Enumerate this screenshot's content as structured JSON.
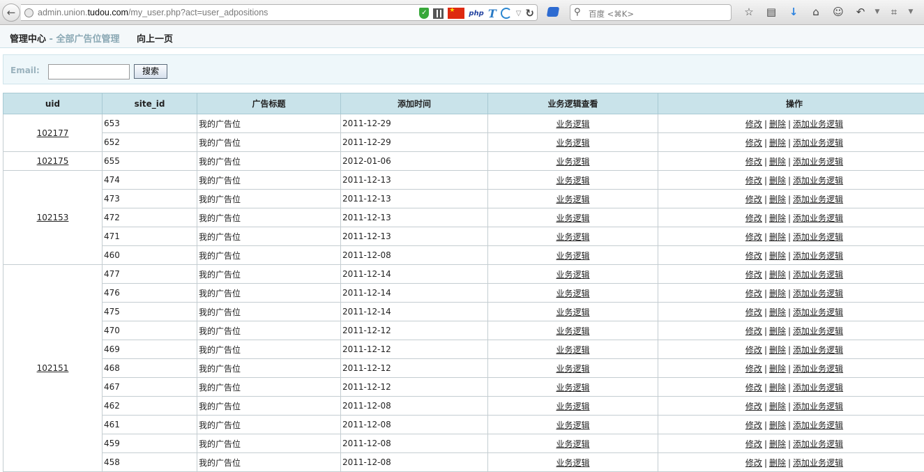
{
  "browser": {
    "url_prefix": "admin.union.",
    "url_host": "tudou.com",
    "url_path": "/my_user.php?act=user_adpositions",
    "search_placeholder": "百度 <⌘K>"
  },
  "nav": {
    "title": "管理中心",
    "subtitle": " - 全部广告位管理",
    "back_link": "向上一页"
  },
  "search": {
    "email_label": "Email:",
    "email_value": "",
    "button_label": "搜索"
  },
  "table": {
    "headers": [
      "uid",
      "site_id",
      "广告标题",
      "添加时间",
      "业务逻辑查看",
      "操作"
    ],
    "link_logic": "业务逻辑",
    "op_edit": "修改",
    "op_delete": "删除",
    "op_add": "添加业务逻辑",
    "groups": [
      {
        "uid": "102177",
        "rows": [
          {
            "site_id": "653",
            "title": "我的广告位",
            "date": "2011-12-29"
          },
          {
            "site_id": "652",
            "title": "我的广告位",
            "date": "2011-12-29"
          }
        ]
      },
      {
        "uid": "102175",
        "rows": [
          {
            "site_id": "655",
            "title": "我的广告位",
            "date": "2012-01-06"
          }
        ]
      },
      {
        "uid": "102153",
        "rows": [
          {
            "site_id": "474",
            "title": "我的广告位",
            "date": "2011-12-13"
          },
          {
            "site_id": "473",
            "title": "我的广告位",
            "date": "2011-12-13"
          },
          {
            "site_id": "472",
            "title": "我的广告位",
            "date": "2011-12-13"
          },
          {
            "site_id": "471",
            "title": "我的广告位",
            "date": "2011-12-13"
          },
          {
            "site_id": "460",
            "title": "我的广告位",
            "date": "2011-12-08"
          }
        ]
      },
      {
        "uid": "102151",
        "rows": [
          {
            "site_id": "477",
            "title": "我的广告位",
            "date": "2011-12-14"
          },
          {
            "site_id": "476",
            "title": "我的广告位",
            "date": "2011-12-14"
          },
          {
            "site_id": "475",
            "title": "我的广告位",
            "date": "2011-12-14"
          },
          {
            "site_id": "470",
            "title": "我的广告位",
            "date": "2011-12-12"
          },
          {
            "site_id": "469",
            "title": "我的广告位",
            "date": "2011-12-12"
          },
          {
            "site_id": "468",
            "title": "我的广告位",
            "date": "2011-12-12"
          },
          {
            "site_id": "467",
            "title": "我的广告位",
            "date": "2011-12-12"
          },
          {
            "site_id": "462",
            "title": "我的广告位",
            "date": "2011-12-08"
          },
          {
            "site_id": "461",
            "title": "我的广告位",
            "date": "2011-12-08"
          },
          {
            "site_id": "459",
            "title": "我的广告位",
            "date": "2011-12-08"
          },
          {
            "site_id": "458",
            "title": "我的广告位",
            "date": "2011-12-08"
          }
        ]
      }
    ]
  }
}
